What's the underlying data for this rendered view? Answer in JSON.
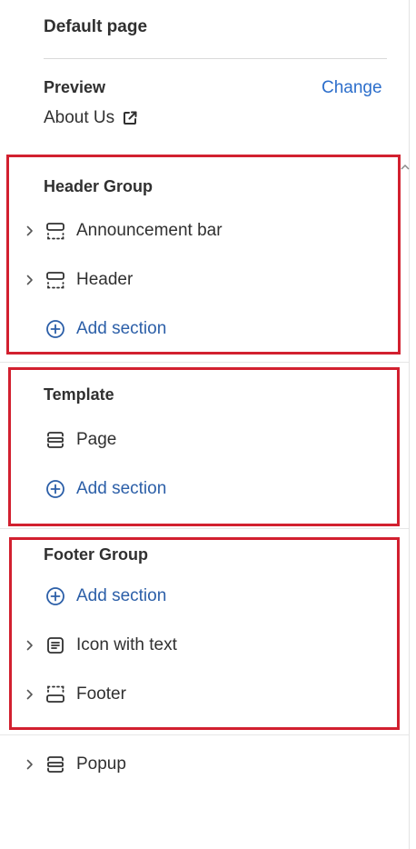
{
  "header": {
    "title": "Default page"
  },
  "preview": {
    "label": "Preview",
    "change_label": "Change",
    "page_name": "About Us"
  },
  "groups": [
    {
      "title": "Header Group",
      "items": [
        {
          "label": "Announcement bar",
          "icon": "section-header-icon",
          "expandable": true
        },
        {
          "label": "Header",
          "icon": "section-header-icon",
          "expandable": true
        }
      ],
      "add_label": "Add section"
    },
    {
      "title": "Template",
      "items": [
        {
          "label": "Page",
          "icon": "section-main-icon",
          "expandable": false
        }
      ],
      "add_label": "Add section"
    },
    {
      "title": "Footer Group",
      "add_label": "Add section",
      "items": [
        {
          "label": "Icon with text",
          "icon": "text-block-icon",
          "expandable": true
        },
        {
          "label": "Footer",
          "icon": "section-footer-icon",
          "expandable": true
        }
      ]
    }
  ],
  "extra_items": [
    {
      "label": "Popup",
      "icon": "section-main-icon",
      "expandable": true
    }
  ],
  "colors": {
    "accent": "#2c6ecb",
    "highlight_box": "#d2202f",
    "text": "#303030"
  }
}
